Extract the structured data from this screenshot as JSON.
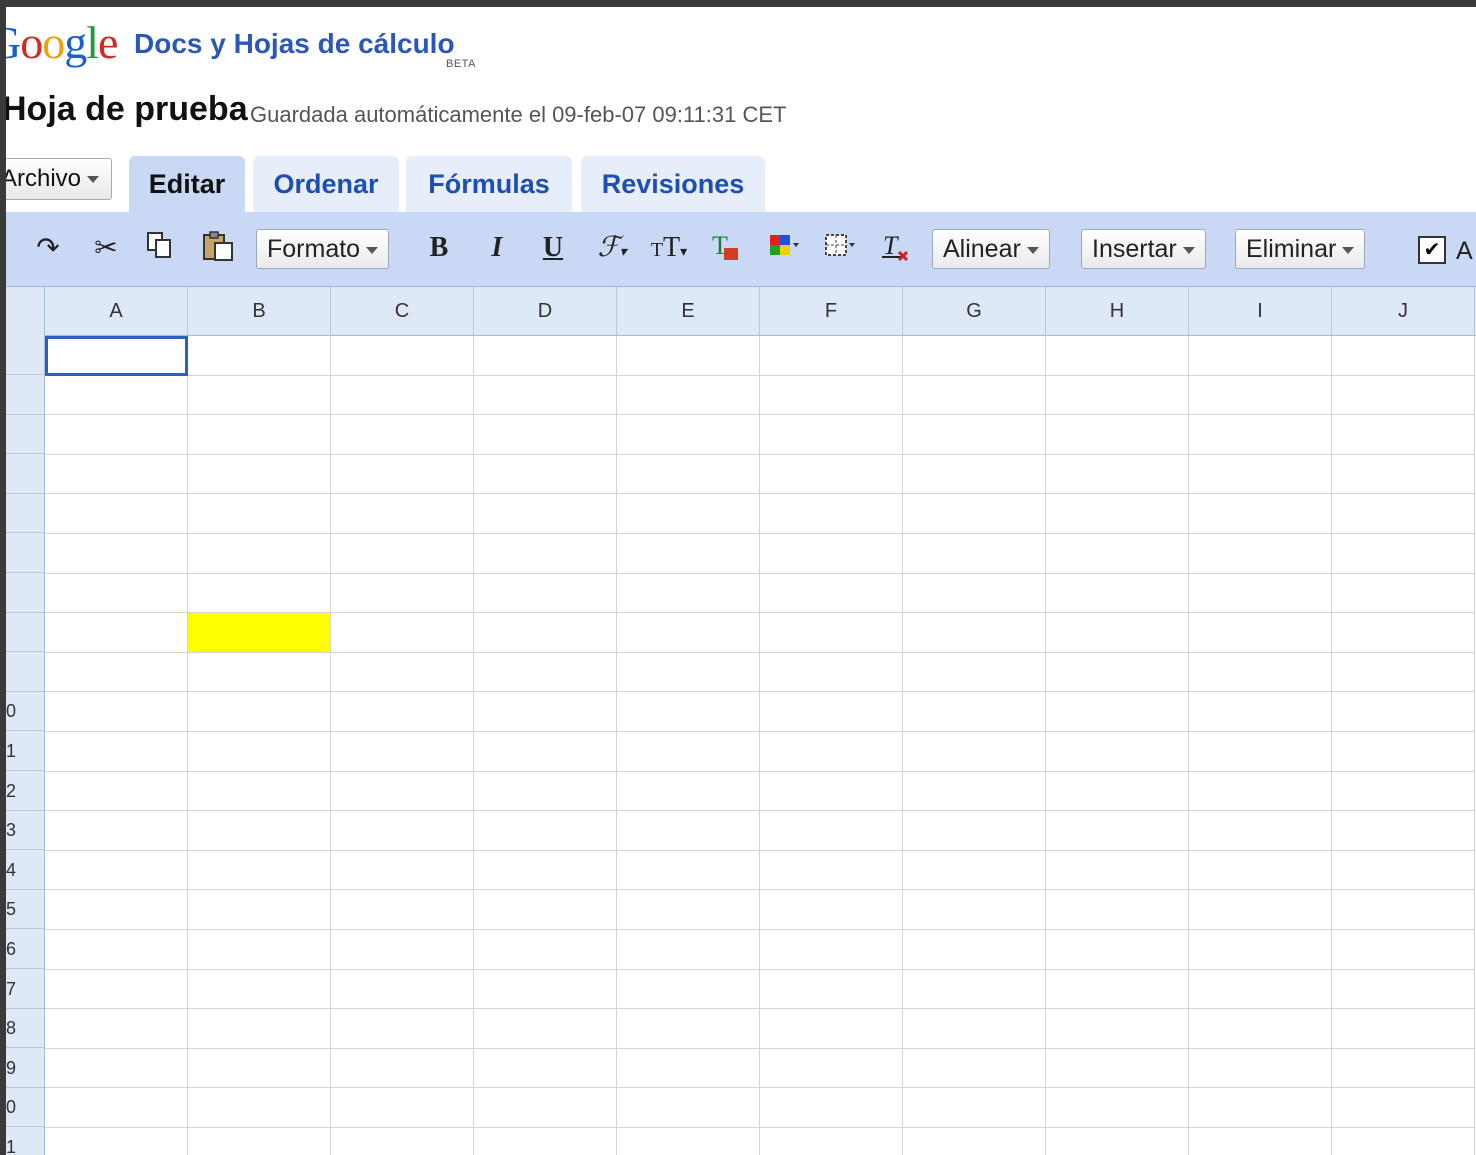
{
  "header": {
    "logo_text": "Google",
    "product_name": "Docs y Hojas de cálculo",
    "beta_label": "BETA"
  },
  "document": {
    "title": "Hoja de prueba",
    "save_status": "Guardada automáticamente el 09-feb-07 09:11:31 CET"
  },
  "menu": {
    "file_label": "Archivo"
  },
  "tabs": [
    {
      "label": "Editar",
      "active": true
    },
    {
      "label": "Ordenar",
      "active": false
    },
    {
      "label": "Fórmulas",
      "active": false
    },
    {
      "label": "Revisiones",
      "active": false
    }
  ],
  "toolbar": {
    "format_label": "Formato",
    "bold_label": "B",
    "italic_label": "I",
    "underline_label": "U",
    "align_label": "Alinear",
    "insert_label": "Insertar",
    "delete_label": "Eliminar",
    "checkbox_label": "A",
    "icons": [
      "redo-icon",
      "cut-icon",
      "copy-icon",
      "paste-icon",
      "font-icon",
      "font-size-icon",
      "text-color-icon",
      "fill-color-icon",
      "borders-icon",
      "clear-format-icon"
    ]
  },
  "grid": {
    "columns": [
      "A",
      "B",
      "C",
      "D",
      "E",
      "F",
      "G",
      "H",
      "I",
      "J"
    ],
    "row_labels": [
      "",
      "",
      "",
      "",
      "",
      "",
      "",
      "",
      "",
      "0",
      "1",
      "2",
      "3",
      "4",
      "5",
      "6",
      "7",
      "8",
      "9",
      "0",
      "1"
    ],
    "selected_cell": "A1",
    "highlighted_cell": "B8",
    "highlight_color": "#ffff00",
    "selection_color": "#2d5fbf"
  }
}
